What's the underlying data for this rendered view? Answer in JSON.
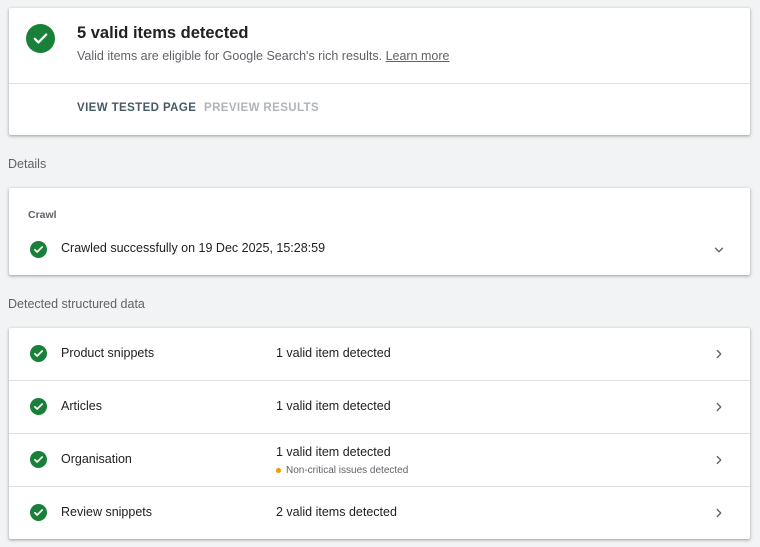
{
  "summary": {
    "title": "5 valid items detected",
    "subtitle": "Valid items are eligible for Google Search's rich results.",
    "learn_more": "Learn more",
    "actions": {
      "view_tested_page": "VIEW TESTED PAGE",
      "preview_results": "PREVIEW RESULTS"
    }
  },
  "details": {
    "section_label": "Details",
    "crawl": {
      "heading": "Crawl",
      "status_text": "Crawled successfully on 19 Dec 2025, 15:28:59"
    }
  },
  "structured_data": {
    "section_label": "Detected structured data",
    "items": [
      {
        "name": "Product snippets",
        "status": "1 valid item detected",
        "note": ""
      },
      {
        "name": "Articles",
        "status": "1 valid item detected",
        "note": ""
      },
      {
        "name": "Organisation",
        "status": "1 valid item detected",
        "note": "Non-critical issues detected"
      },
      {
        "name": "Review snippets",
        "status": "2 valid items detected",
        "note": ""
      }
    ]
  },
  "colors": {
    "success": "#188038",
    "warning": "#f29900",
    "background": "#f1f3f4",
    "action": "#455a64",
    "disabled_action": "#b0b5b9"
  },
  "icons": {
    "status": "check-circle-icon",
    "expand": "chevron-down-icon",
    "open": "chevron-right-icon"
  }
}
